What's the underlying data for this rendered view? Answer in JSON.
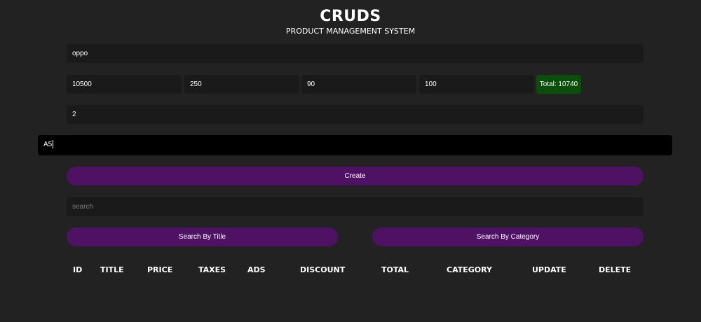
{
  "header": {
    "title": "CRUDS",
    "subtitle": "PRODUCT MANAGEMENT SYSTEM"
  },
  "form": {
    "title_value": "oppo",
    "price_value": "10500",
    "taxes_value": "250",
    "ads_value": "90",
    "discount_value": "100",
    "total_label": "Total: 10740",
    "count_value": "2",
    "category_value": "A5",
    "create_label": "Create"
  },
  "search": {
    "placeholder": "search",
    "by_title_label": "Search By Title",
    "by_category_label": "Search By Category"
  },
  "table": {
    "headers": [
      "ID",
      "TITLE",
      "PRICE",
      "TAXES",
      "ADS",
      "DISCOUNT",
      "TOTAL",
      "CATEGORY",
      "UPDATE",
      "DELETE"
    ]
  },
  "colors": {
    "background": "#222222",
    "input_background": "#1a1a1a",
    "button_purple": "#4f1164",
    "total_green": "#0b4d0b",
    "focused_input": "#000000"
  }
}
